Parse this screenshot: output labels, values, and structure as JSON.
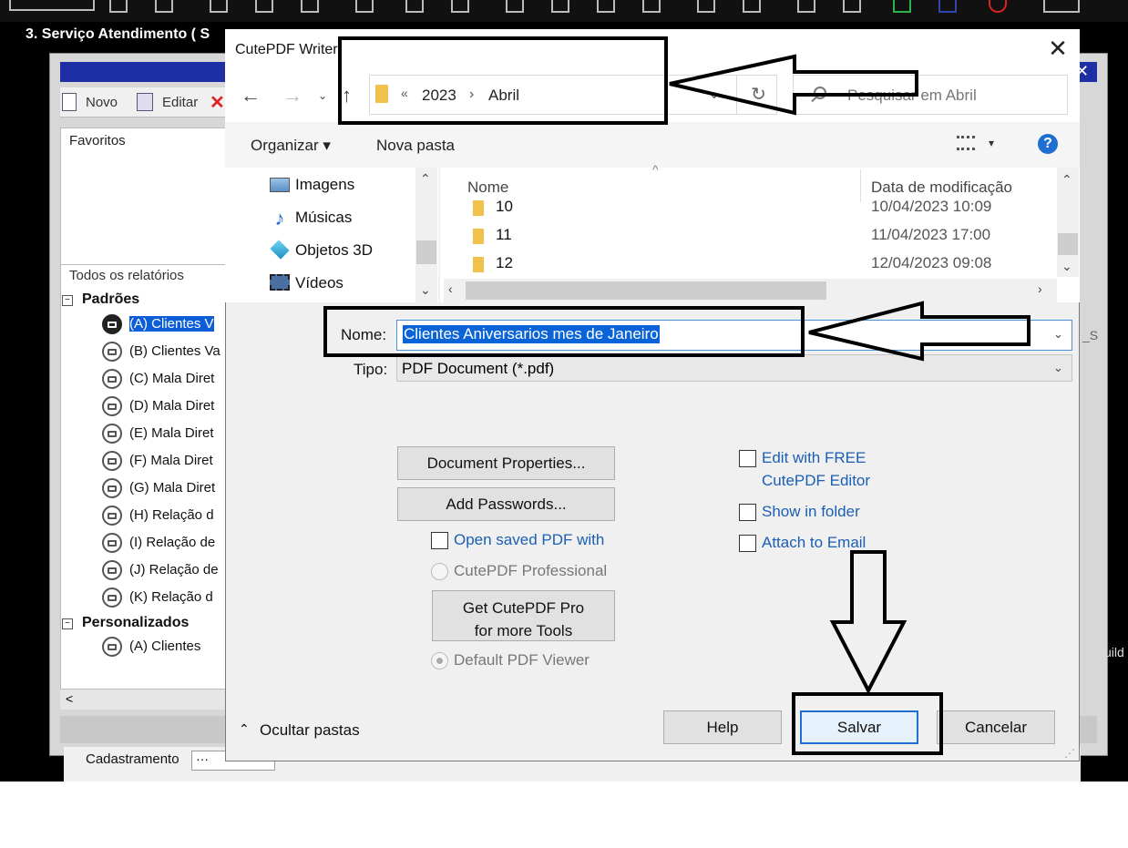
{
  "background_app": {
    "window_title": "3. Serviço Atendimento ( S",
    "tools": {
      "novo": "Novo",
      "editar": "Editar"
    },
    "favoritos_label": "Favoritos",
    "reports_label": "Todos os relatórios",
    "group_padroes": "Padrões",
    "group_personalizados": "Personalizados",
    "reports": [
      "(A) Clientes V",
      "(B) Clientes Va",
      "(C) Mala Diret",
      "(D) Mala Diret",
      "(E) Mala Diret",
      "(F) Mala Diret",
      "(G) Mala Diret",
      "(H) Relação d",
      "(I) Relação de",
      "(J) Relação de",
      "(K) Relação d"
    ],
    "custom_reports": [
      "(A) Clientes"
    ],
    "cadastramento_label": "Cadastramento",
    "cadastramento_value": "···",
    "side_text_1": "_S",
    "side_text_2": "uild"
  },
  "dialog": {
    "title": "CutePDF Writer",
    "address": {
      "part1": "2023",
      "part2": "Abril",
      "chevron": "«"
    },
    "search_placeholder": "Pesquisar em Abril",
    "commands": {
      "organizar": "Organizar ▾",
      "nova_pasta": "Nova pasta"
    },
    "tree_items": [
      "Imagens",
      "Músicas",
      "Objetos 3D",
      "Vídeos"
    ],
    "columns": {
      "name": "Nome",
      "date": "Data de modificação"
    },
    "files": [
      {
        "name": "10",
        "date": "10/04/2023 10:09"
      },
      {
        "name": "11",
        "date": "11/04/2023 17:00"
      },
      {
        "name": "12",
        "date": "12/04/2023 09:08"
      }
    ],
    "nome_label": "Nome:",
    "nome_value": "Clientes Aniversarios mes de Janeiro",
    "tipo_label": "Tipo:",
    "tipo_value": "PDF Document (*.pdf)",
    "buttons": {
      "document_properties": "Document Properties...",
      "add_passwords": "Add Passwords...",
      "get_pro_line1": "Get CutePDF Pro",
      "get_pro_line2": "for more Tools",
      "help": "Help",
      "salvar": "Salvar",
      "cancelar": "Cancelar"
    },
    "options": {
      "open_saved": "Open saved PDF with",
      "cutepdf_professional": "CutePDF Professional",
      "default_viewer": "Default PDF Viewer",
      "edit_free_line1": "Edit with FREE",
      "edit_free_line2": "CutePDF Editor",
      "show_in_folder": "Show in folder",
      "attach_email": "Attach to Email"
    },
    "ocultar_pastas": "Ocultar pastas"
  },
  "colors": {
    "accent": "#0a64d8",
    "link": "#1a5fb4",
    "annotation": "#000000"
  }
}
